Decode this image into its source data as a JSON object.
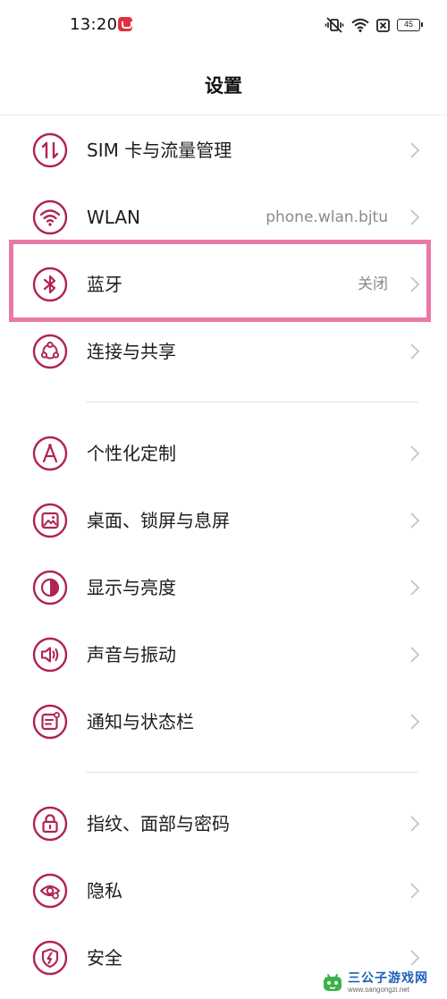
{
  "status_bar": {
    "time": "13:20",
    "battery": "45"
  },
  "header": {
    "title": "设置"
  },
  "colors": {
    "accent": "#b0244f",
    "highlight": "#e879a6"
  },
  "settings": [
    {
      "label": "SIM 卡与流量管理",
      "value": "",
      "icon": "sim-data-icon"
    },
    {
      "label": "WLAN",
      "value": "phone.wlan.bjtu",
      "icon": "wifi-icon"
    },
    {
      "label": "蓝牙",
      "value": "关闭",
      "icon": "bluetooth-icon"
    },
    {
      "label": "连接与共享",
      "value": "",
      "icon": "share-connection-icon"
    },
    {
      "label": "个性化定制",
      "value": "",
      "icon": "personalization-icon"
    },
    {
      "label": "桌面、锁屏与息屏",
      "value": "",
      "icon": "wallpaper-icon"
    },
    {
      "label": "显示与亮度",
      "value": "",
      "icon": "brightness-icon"
    },
    {
      "label": "声音与振动",
      "value": "",
      "icon": "speaker-icon"
    },
    {
      "label": "通知与状态栏",
      "value": "",
      "icon": "notification-icon"
    },
    {
      "label": "指纹、面部与密码",
      "value": "",
      "icon": "lock-icon"
    },
    {
      "label": "隐私",
      "value": "",
      "icon": "privacy-eye-icon"
    },
    {
      "label": "安全",
      "value": "",
      "icon": "security-shield-icon"
    }
  ],
  "watermark": {
    "title": "三公子游戏网",
    "url": "www.sangongzi.net"
  }
}
